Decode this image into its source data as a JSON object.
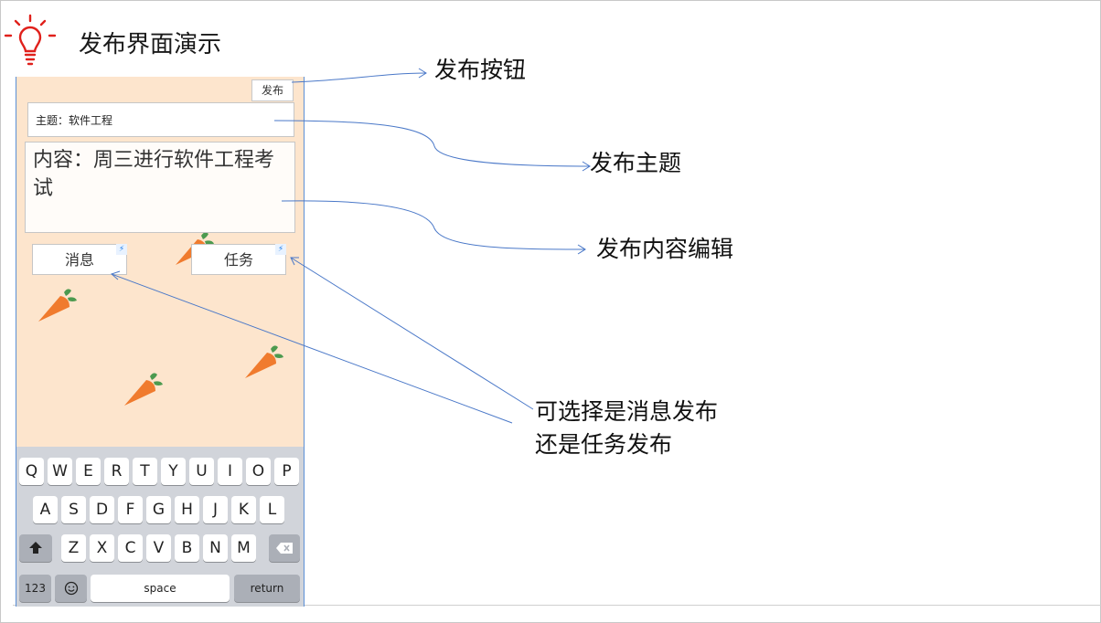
{
  "slide": {
    "title": "发布界面演示"
  },
  "phone": {
    "publish_button": "发布",
    "subject_field": "主题：软件工程",
    "content_field": "内容：周三进行软件工程考试",
    "message_button": "消息",
    "task_button": "任务",
    "keyboard": {
      "row1": [
        "Q",
        "W",
        "E",
        "R",
        "T",
        "Y",
        "U",
        "I",
        "O",
        "P"
      ],
      "row2": [
        "A",
        "S",
        "D",
        "F",
        "G",
        "H",
        "J",
        "K",
        "L"
      ],
      "row3": [
        "Z",
        "X",
        "C",
        "V",
        "B",
        "N",
        "M"
      ],
      "numbers_key": "123",
      "space_key": "space",
      "return_key": "return",
      "shift_icon": "shift-icon",
      "backspace_icon": "backspace-icon",
      "emoji_icon": "emoji-icon"
    }
  },
  "annotations": {
    "publish_button": "发布按钮",
    "publish_subject": "发布主题",
    "publish_content_edit": "发布内容编辑",
    "type_choice_line1": "可选择是消息发布",
    "type_choice_line2": "还是任务发布"
  },
  "colors": {
    "title_icon": "#e0201b",
    "phone_background": "#fde5cd",
    "arrow_line": "#4a78c8",
    "carrot_orange": "#f07b2e",
    "carrot_leaf": "#4c9a4f",
    "quick_badge": "#1e7ce6"
  }
}
